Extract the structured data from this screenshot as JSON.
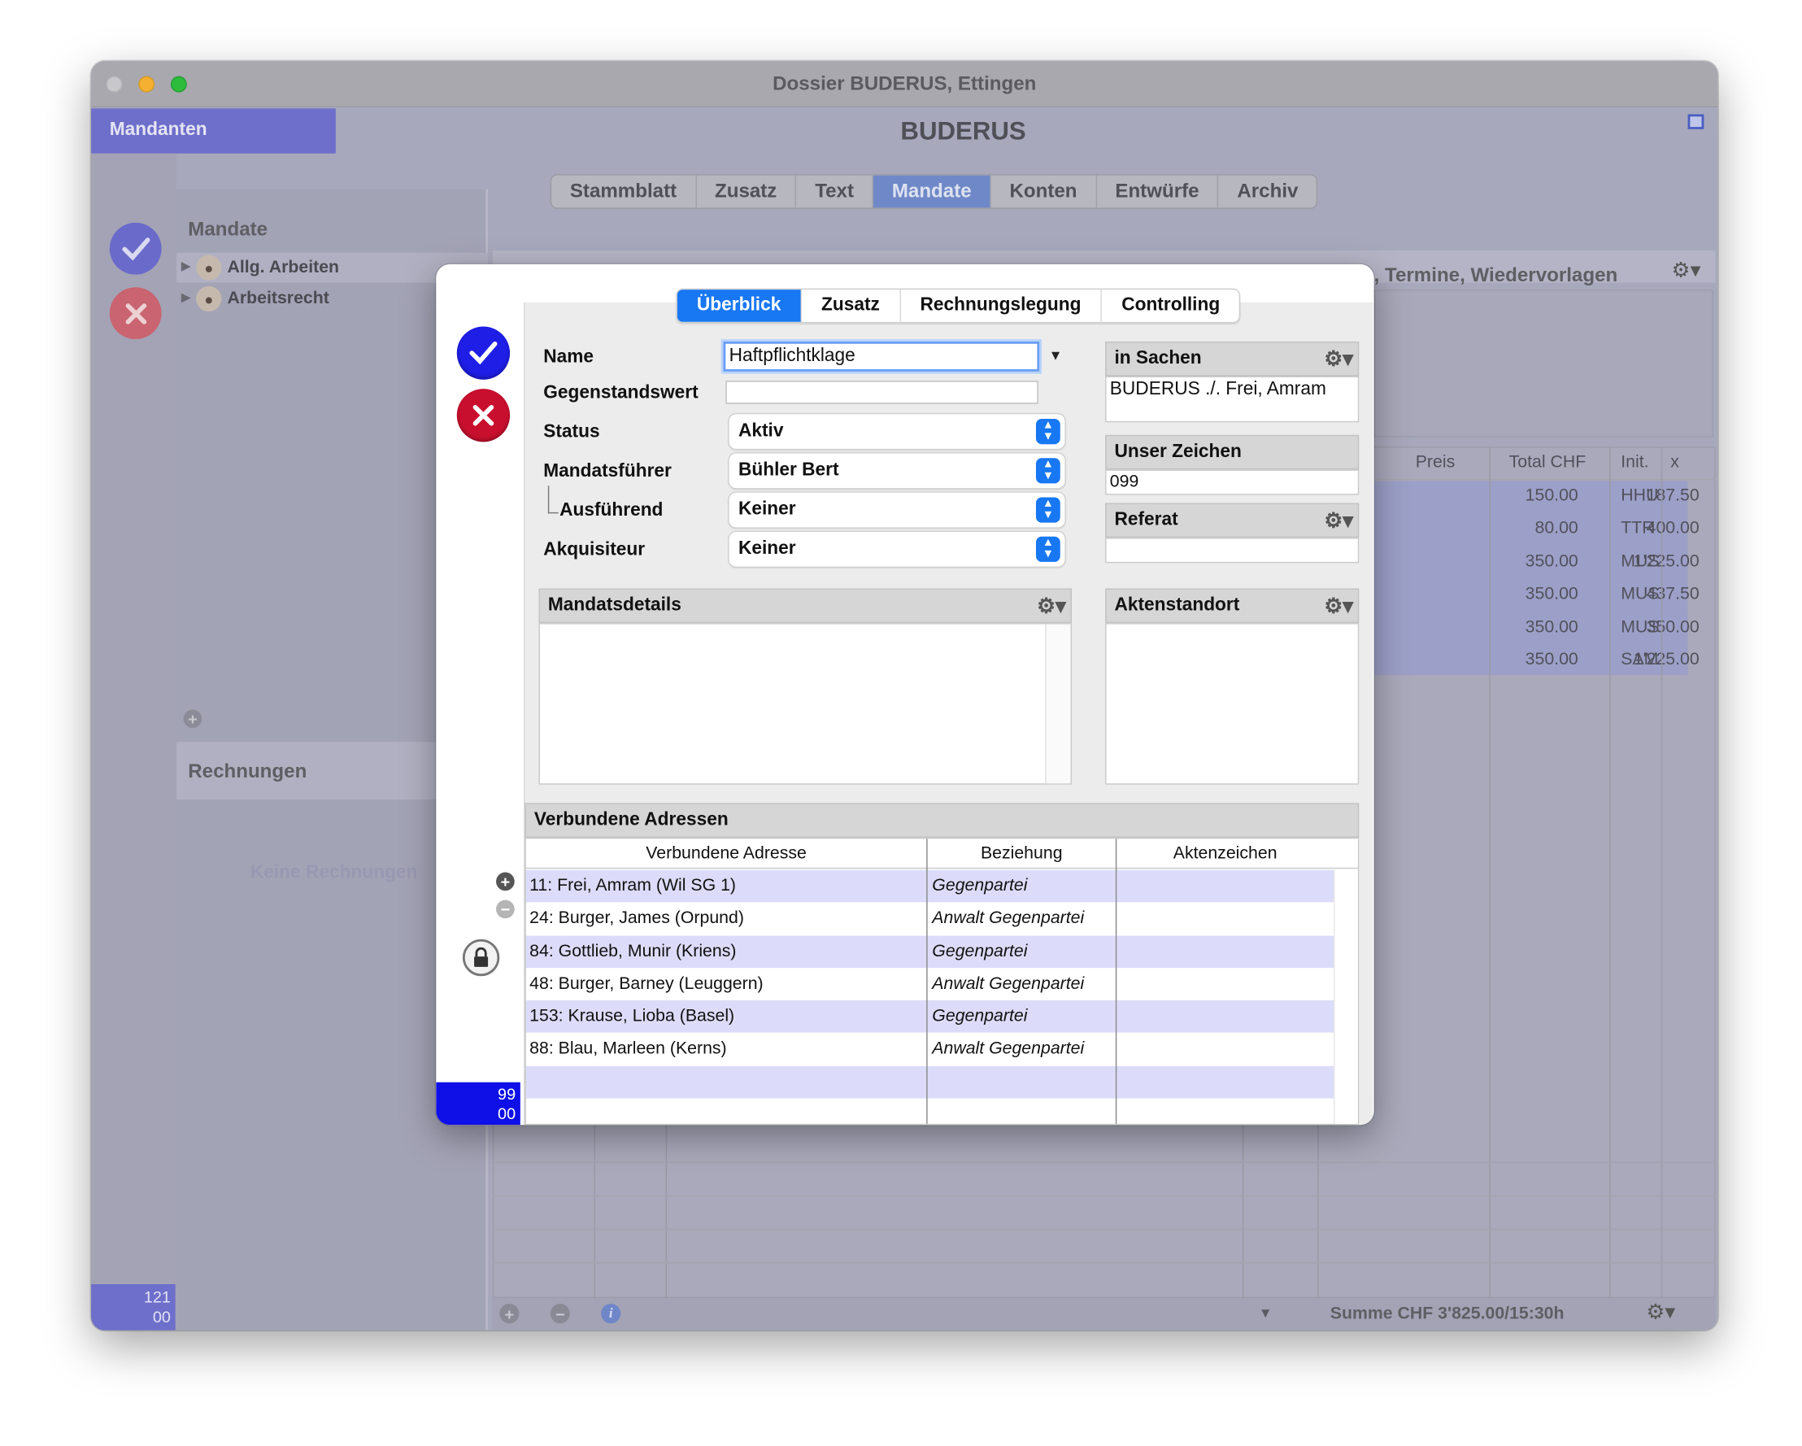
{
  "window": {
    "title": "Dossier BUDERUS, Ettingen",
    "header": "BUDERUS"
  },
  "sidebar": {
    "mandanten_label": "Mandanten",
    "counter_top": "121",
    "counter_bottom": "00"
  },
  "tabs": [
    "Stammblatt",
    "Zusatz",
    "Text",
    "Mandate",
    "Konten",
    "Entwürfe",
    "Archiv"
  ],
  "active_tab": "Mandate",
  "mandate": {
    "title": "Mandate",
    "items": [
      "Allg. Arbeiten",
      "Arbeitsrecht"
    ]
  },
  "rechnungen": {
    "title": "Rechnungen",
    "empty": "Keine Rechnungen"
  },
  "right_panel": {
    "header": ", Termine, Wiedervorlagen",
    "columns": [
      "Preis",
      "Total CHF",
      "Init.",
      "x"
    ],
    "rows": [
      {
        "preis": "150.00",
        "total": "187.50",
        "init": "HHU"
      },
      {
        "preis": "80.00",
        "total": "400.00",
        "init": "TTR"
      },
      {
        "preis": "350.00",
        "total": "1'225.00",
        "init": "MUS"
      },
      {
        "preis": "350.00",
        "total": "437.50",
        "init": "MUS"
      },
      {
        "preis": "350.00",
        "total": "350.00",
        "init": "MUS"
      },
      {
        "preis": "350.00",
        "total": "1'225.00",
        "init": "SAM"
      }
    ],
    "summe": "Summe CHF 3'825.00/15:30h"
  },
  "dialog": {
    "tabs": [
      "Überblick",
      "Zusatz",
      "Rechnungslegung",
      "Controlling"
    ],
    "active_tab": "Überblick",
    "fields": {
      "name_label": "Name",
      "name_value": "Haftpflichtklage",
      "gegenstandswert_label": "Gegenstandswert",
      "gegenstandswert_value": "",
      "status_label": "Status",
      "status_value": "Aktiv",
      "mandatsfuehrer_label": "Mandatsführer",
      "mandatsfuehrer_value": "Bühler Bert",
      "ausfuehrend_label": "Ausführend",
      "ausfuehrend_value": "Keiner",
      "akquisiteur_label": "Akquisiteur",
      "akquisiteur_value": "Keiner"
    },
    "in_sachen": {
      "label": "in Sachen",
      "value": "BUDERUS ./. Frei, Amram"
    },
    "unser_zeichen": {
      "label": "Unser Zeichen",
      "value": "099"
    },
    "referat": {
      "label": "Referat",
      "value": ""
    },
    "mandatsdetails": {
      "label": "Mandatsdetails"
    },
    "aktenstandort": {
      "label": "Aktenstandort"
    },
    "verbundene": {
      "title": "Verbundene Adressen",
      "columns": [
        "Verbundene Adresse",
        "Beziehung",
        "Aktenzeichen"
      ],
      "rows": [
        {
          "adresse": "11: Frei, Amram (Wil SG 1)",
          "beziehung": "Gegenpartei",
          "akz": ""
        },
        {
          "adresse": "24: Burger, James (Orpund)",
          "beziehung": "Anwalt Gegenpartei",
          "akz": ""
        },
        {
          "adresse": "84: Gottlieb, Munir (Kriens)",
          "beziehung": "Gegenpartei",
          "akz": ""
        },
        {
          "adresse": "48: Burger, Barney (Leuggern)",
          "beziehung": "Anwalt Gegenpartei",
          "akz": ""
        },
        {
          "adresse": "153: Krause, Lioba (Basel)",
          "beziehung": "Gegenpartei",
          "akz": ""
        },
        {
          "adresse": "88: Blau, Marleen (Kerns)",
          "beziehung": "Anwalt Gegenpartei",
          "akz": ""
        }
      ]
    },
    "counter_top": "99",
    "counter_bottom": "00"
  },
  "colors": {
    "accent": "#1877f2",
    "sidebar": "#6e6ecb",
    "row_highlight": "#dcdcfa"
  }
}
